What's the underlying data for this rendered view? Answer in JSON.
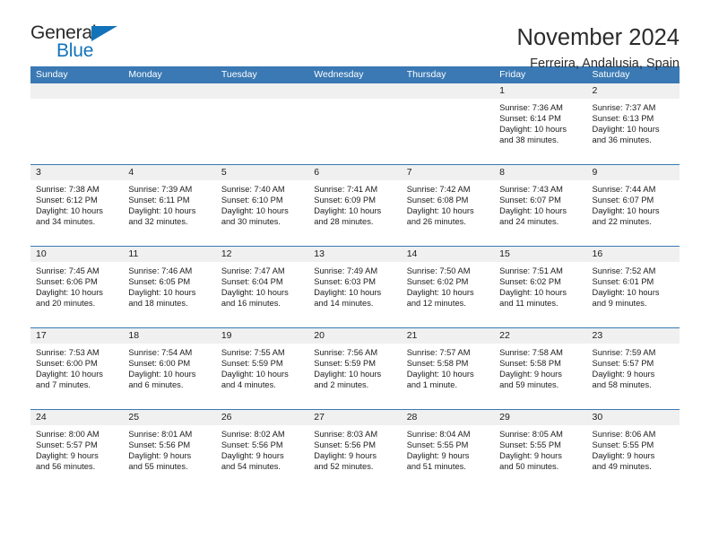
{
  "brand": {
    "name_part1": "General",
    "name_part2": "Blue",
    "triangle_icon": "triangle-icon",
    "color_dark": "#2a2a2a",
    "color_blue": "#1373ba"
  },
  "header": {
    "title": "November 2024",
    "subtitle": "Ferreira, Andalusia, Spain"
  },
  "theme": {
    "header_blue": "#3a79b4",
    "daynum_band": "#f0f0f0",
    "text": "#1c1c1c"
  },
  "calendar": {
    "weekdays": [
      "Sunday",
      "Monday",
      "Tuesday",
      "Wednesday",
      "Thursday",
      "Friday",
      "Saturday"
    ],
    "weeks": [
      {
        "days": [
          {
            "num": "",
            "sunrise": "",
            "sunset": "",
            "daylight1": "",
            "daylight2": ""
          },
          {
            "num": "",
            "sunrise": "",
            "sunset": "",
            "daylight1": "",
            "daylight2": ""
          },
          {
            "num": "",
            "sunrise": "",
            "sunset": "",
            "daylight1": "",
            "daylight2": ""
          },
          {
            "num": "",
            "sunrise": "",
            "sunset": "",
            "daylight1": "",
            "daylight2": ""
          },
          {
            "num": "",
            "sunrise": "",
            "sunset": "",
            "daylight1": "",
            "daylight2": ""
          },
          {
            "num": "1",
            "sunrise": "Sunrise: 7:36 AM",
            "sunset": "Sunset: 6:14 PM",
            "daylight1": "Daylight: 10 hours",
            "daylight2": "and 38 minutes."
          },
          {
            "num": "2",
            "sunrise": "Sunrise: 7:37 AM",
            "sunset": "Sunset: 6:13 PM",
            "daylight1": "Daylight: 10 hours",
            "daylight2": "and 36 minutes."
          }
        ]
      },
      {
        "days": [
          {
            "num": "3",
            "sunrise": "Sunrise: 7:38 AM",
            "sunset": "Sunset: 6:12 PM",
            "daylight1": "Daylight: 10 hours",
            "daylight2": "and 34 minutes."
          },
          {
            "num": "4",
            "sunrise": "Sunrise: 7:39 AM",
            "sunset": "Sunset: 6:11 PM",
            "daylight1": "Daylight: 10 hours",
            "daylight2": "and 32 minutes."
          },
          {
            "num": "5",
            "sunrise": "Sunrise: 7:40 AM",
            "sunset": "Sunset: 6:10 PM",
            "daylight1": "Daylight: 10 hours",
            "daylight2": "and 30 minutes."
          },
          {
            "num": "6",
            "sunrise": "Sunrise: 7:41 AM",
            "sunset": "Sunset: 6:09 PM",
            "daylight1": "Daylight: 10 hours",
            "daylight2": "and 28 minutes."
          },
          {
            "num": "7",
            "sunrise": "Sunrise: 7:42 AM",
            "sunset": "Sunset: 6:08 PM",
            "daylight1": "Daylight: 10 hours",
            "daylight2": "and 26 minutes."
          },
          {
            "num": "8",
            "sunrise": "Sunrise: 7:43 AM",
            "sunset": "Sunset: 6:07 PM",
            "daylight1": "Daylight: 10 hours",
            "daylight2": "and 24 minutes."
          },
          {
            "num": "9",
            "sunrise": "Sunrise: 7:44 AM",
            "sunset": "Sunset: 6:07 PM",
            "daylight1": "Daylight: 10 hours",
            "daylight2": "and 22 minutes."
          }
        ]
      },
      {
        "days": [
          {
            "num": "10",
            "sunrise": "Sunrise: 7:45 AM",
            "sunset": "Sunset: 6:06 PM",
            "daylight1": "Daylight: 10 hours",
            "daylight2": "and 20 minutes."
          },
          {
            "num": "11",
            "sunrise": "Sunrise: 7:46 AM",
            "sunset": "Sunset: 6:05 PM",
            "daylight1": "Daylight: 10 hours",
            "daylight2": "and 18 minutes."
          },
          {
            "num": "12",
            "sunrise": "Sunrise: 7:47 AM",
            "sunset": "Sunset: 6:04 PM",
            "daylight1": "Daylight: 10 hours",
            "daylight2": "and 16 minutes."
          },
          {
            "num": "13",
            "sunrise": "Sunrise: 7:49 AM",
            "sunset": "Sunset: 6:03 PM",
            "daylight1": "Daylight: 10 hours",
            "daylight2": "and 14 minutes."
          },
          {
            "num": "14",
            "sunrise": "Sunrise: 7:50 AM",
            "sunset": "Sunset: 6:02 PM",
            "daylight1": "Daylight: 10 hours",
            "daylight2": "and 12 minutes."
          },
          {
            "num": "15",
            "sunrise": "Sunrise: 7:51 AM",
            "sunset": "Sunset: 6:02 PM",
            "daylight1": "Daylight: 10 hours",
            "daylight2": "and 11 minutes."
          },
          {
            "num": "16",
            "sunrise": "Sunrise: 7:52 AM",
            "sunset": "Sunset: 6:01 PM",
            "daylight1": "Daylight: 10 hours",
            "daylight2": "and 9 minutes."
          }
        ]
      },
      {
        "days": [
          {
            "num": "17",
            "sunrise": "Sunrise: 7:53 AM",
            "sunset": "Sunset: 6:00 PM",
            "daylight1": "Daylight: 10 hours",
            "daylight2": "and 7 minutes."
          },
          {
            "num": "18",
            "sunrise": "Sunrise: 7:54 AM",
            "sunset": "Sunset: 6:00 PM",
            "daylight1": "Daylight: 10 hours",
            "daylight2": "and 6 minutes."
          },
          {
            "num": "19",
            "sunrise": "Sunrise: 7:55 AM",
            "sunset": "Sunset: 5:59 PM",
            "daylight1": "Daylight: 10 hours",
            "daylight2": "and 4 minutes."
          },
          {
            "num": "20",
            "sunrise": "Sunrise: 7:56 AM",
            "sunset": "Sunset: 5:59 PM",
            "daylight1": "Daylight: 10 hours",
            "daylight2": "and 2 minutes."
          },
          {
            "num": "21",
            "sunrise": "Sunrise: 7:57 AM",
            "sunset": "Sunset: 5:58 PM",
            "daylight1": "Daylight: 10 hours",
            "daylight2": "and 1 minute."
          },
          {
            "num": "22",
            "sunrise": "Sunrise: 7:58 AM",
            "sunset": "Sunset: 5:58 PM",
            "daylight1": "Daylight: 9 hours",
            "daylight2": "and 59 minutes."
          },
          {
            "num": "23",
            "sunrise": "Sunrise: 7:59 AM",
            "sunset": "Sunset: 5:57 PM",
            "daylight1": "Daylight: 9 hours",
            "daylight2": "and 58 minutes."
          }
        ]
      },
      {
        "days": [
          {
            "num": "24",
            "sunrise": "Sunrise: 8:00 AM",
            "sunset": "Sunset: 5:57 PM",
            "daylight1": "Daylight: 9 hours",
            "daylight2": "and 56 minutes."
          },
          {
            "num": "25",
            "sunrise": "Sunrise: 8:01 AM",
            "sunset": "Sunset: 5:56 PM",
            "daylight1": "Daylight: 9 hours",
            "daylight2": "and 55 minutes."
          },
          {
            "num": "26",
            "sunrise": "Sunrise: 8:02 AM",
            "sunset": "Sunset: 5:56 PM",
            "daylight1": "Daylight: 9 hours",
            "daylight2": "and 54 minutes."
          },
          {
            "num": "27",
            "sunrise": "Sunrise: 8:03 AM",
            "sunset": "Sunset: 5:56 PM",
            "daylight1": "Daylight: 9 hours",
            "daylight2": "and 52 minutes."
          },
          {
            "num": "28",
            "sunrise": "Sunrise: 8:04 AM",
            "sunset": "Sunset: 5:55 PM",
            "daylight1": "Daylight: 9 hours",
            "daylight2": "and 51 minutes."
          },
          {
            "num": "29",
            "sunrise": "Sunrise: 8:05 AM",
            "sunset": "Sunset: 5:55 PM",
            "daylight1": "Daylight: 9 hours",
            "daylight2": "and 50 minutes."
          },
          {
            "num": "30",
            "sunrise": "Sunrise: 8:06 AM",
            "sunset": "Sunset: 5:55 PM",
            "daylight1": "Daylight: 9 hours",
            "daylight2": "and 49 minutes."
          }
        ]
      }
    ]
  }
}
